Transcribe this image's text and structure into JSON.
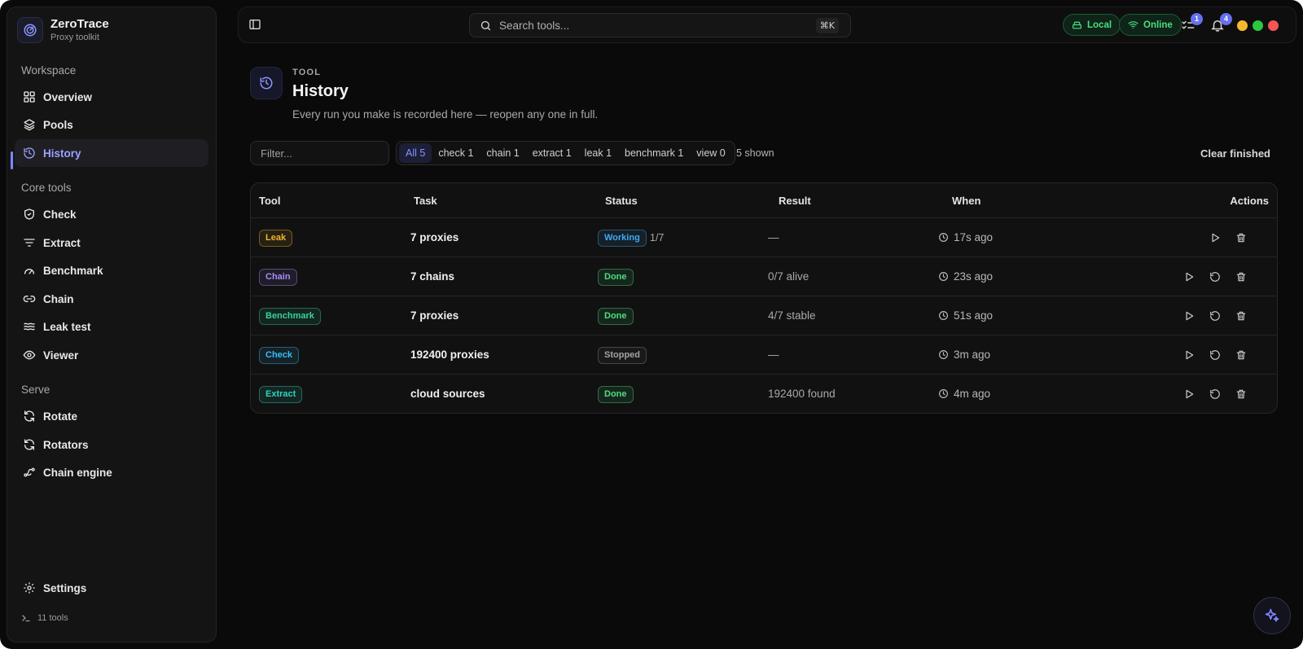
{
  "app": {
    "name": "ZeroTrace",
    "subtitle": "Proxy toolkit"
  },
  "sidebar": {
    "sections": [
      {
        "label": "Workspace"
      },
      {
        "label": "Core tools"
      },
      {
        "label": "Serve"
      }
    ],
    "items": [
      {
        "label": "Overview",
        "icon": "grid-icon"
      },
      {
        "label": "Pools",
        "icon": "layers-icon"
      },
      {
        "label": "History",
        "icon": "history-icon",
        "active": true
      },
      {
        "label": "Check",
        "icon": "shield-check-icon"
      },
      {
        "label": "Extract",
        "icon": "filter-lines-icon"
      },
      {
        "label": "Benchmark",
        "icon": "gauge-icon"
      },
      {
        "label": "Chain",
        "icon": "link-icon"
      },
      {
        "label": "Leak test",
        "icon": "waves-icon"
      },
      {
        "label": "Viewer",
        "icon": "eye-icon"
      },
      {
        "label": "Rotate",
        "icon": "refresh-icon"
      },
      {
        "label": "Rotators",
        "icon": "refresh-icon"
      },
      {
        "label": "Chain engine",
        "icon": "spline-icon"
      }
    ],
    "settings_label": "Settings",
    "tools_count": "11 tools"
  },
  "topbar": {
    "search_placeholder": "Search tools...",
    "search_shortcut": "⌘K",
    "local_label": "Local",
    "online_label": "Online",
    "tasks_badge": "1",
    "notifications_badge": "4"
  },
  "header": {
    "eyebrow": "TOOL",
    "title": "History",
    "description": "Every run you make is recorded here — reopen any one in full."
  },
  "filters": {
    "placeholder": "Filter...",
    "chips": [
      {
        "label": "All 5",
        "active": true
      },
      {
        "label": "check 1"
      },
      {
        "label": "chain 1"
      },
      {
        "label": "extract 1"
      },
      {
        "label": "leak 1"
      },
      {
        "label": "benchmark 1"
      },
      {
        "label": "view 0"
      }
    ],
    "shown": "5 shown",
    "clear_label": "Clear finished"
  },
  "table": {
    "columns": [
      "Tool",
      "Task",
      "Status",
      "Result",
      "When",
      "Actions"
    ],
    "rows": [
      {
        "tool": "Leak",
        "tool_color": "#f0b429",
        "task": "7 proxies",
        "status": "Working",
        "status_color": "#3fa9f5",
        "progress": "1/7",
        "result": "—",
        "when": "17s ago",
        "rerun": false
      },
      {
        "tool": "Chain",
        "tool_color": "#a78bfa",
        "task": "7 chains",
        "status": "Done",
        "status_color": "#4ade80",
        "progress": "",
        "result": "0/7 alive",
        "when": "23s ago",
        "rerun": true
      },
      {
        "tool": "Benchmark",
        "tool_color": "#34d399",
        "task": "7 proxies",
        "status": "Done",
        "status_color": "#4ade80",
        "progress": "",
        "result": "4/7 stable",
        "when": "51s ago",
        "rerun": true
      },
      {
        "tool": "Check",
        "tool_color": "#38bdf8",
        "task": "192400 proxies",
        "status": "Stopped",
        "status_color": "#a3a3a3",
        "progress": "",
        "result": "—",
        "when": "3m ago",
        "rerun": true
      },
      {
        "tool": "Extract",
        "tool_color": "#2dd4bf",
        "task": "cloud sources",
        "status": "Done",
        "status_color": "#4ade80",
        "progress": "",
        "result": "192400 found",
        "when": "4m ago",
        "rerun": true
      }
    ]
  },
  "colors": {
    "accent": "#7c86ff",
    "online": "#4ade80",
    "traffic_yellow": "#f5b82e",
    "traffic_green": "#2bc840",
    "traffic_red": "#f55454"
  }
}
